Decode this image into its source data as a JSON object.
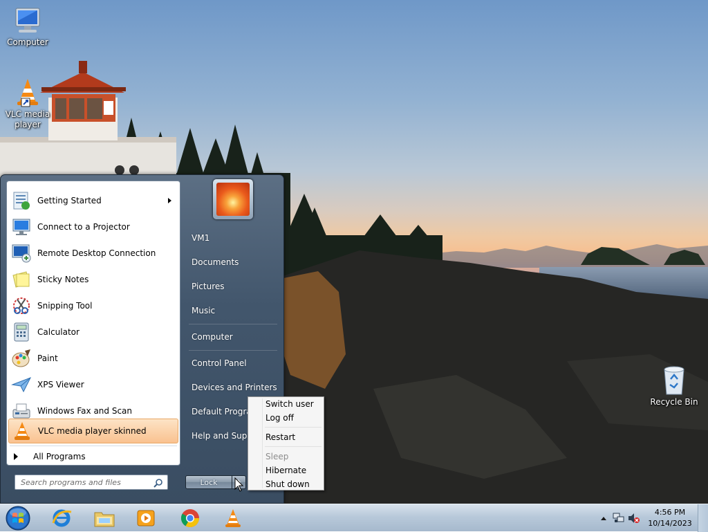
{
  "desktop": {
    "icons": [
      {
        "label": "Computer",
        "icon": "computer-icon"
      },
      {
        "label": "VLC media player",
        "icon": "vlc-cone-icon"
      },
      {
        "label": "Recycle Bin",
        "icon": "recycle-bin-icon"
      }
    ]
  },
  "start_menu": {
    "programs": [
      {
        "label": "Getting Started",
        "icon": "getting-started-icon",
        "has_submenu": true
      },
      {
        "label": "Connect to a Projector",
        "icon": "projector-icon"
      },
      {
        "label": "Remote Desktop Connection",
        "icon": "remote-desktop-icon"
      },
      {
        "label": "Sticky Notes",
        "icon": "sticky-notes-icon"
      },
      {
        "label": "Snipping Tool",
        "icon": "snipping-tool-icon"
      },
      {
        "label": "Calculator",
        "icon": "calculator-icon"
      },
      {
        "label": "Paint",
        "icon": "paint-icon"
      },
      {
        "label": "XPS Viewer",
        "icon": "xps-viewer-icon"
      },
      {
        "label": "Windows Fax and Scan",
        "icon": "fax-scan-icon"
      },
      {
        "label": "VLC media player skinned",
        "icon": "vlc-cone-icon",
        "highlighted": true
      }
    ],
    "all_programs": "All Programs",
    "search_placeholder": "Search programs and files",
    "right_links": [
      {
        "label": "VM1"
      },
      {
        "label": "Documents"
      },
      {
        "label": "Pictures"
      },
      {
        "label": "Music"
      },
      {
        "label": "Computer"
      },
      {
        "label": "Control Panel"
      },
      {
        "label": "Devices and Printers"
      },
      {
        "label": "Default Programs"
      },
      {
        "label": "Help and Support"
      }
    ],
    "lock_label": "Lock"
  },
  "power_menu": {
    "items": [
      {
        "label": "Switch user",
        "enabled": true
      },
      {
        "label": "Log off",
        "enabled": true
      },
      {
        "label": "Restart",
        "enabled": true
      },
      {
        "label": "Sleep",
        "enabled": false
      },
      {
        "label": "Hibernate",
        "enabled": true
      },
      {
        "label": "Shut down",
        "enabled": true
      }
    ]
  },
  "taskbar": {
    "pinned": [
      {
        "icon": "internet-explorer-icon"
      },
      {
        "icon": "file-explorer-icon"
      },
      {
        "icon": "media-player-icon"
      },
      {
        "icon": "chrome-icon"
      },
      {
        "icon": "vlc-cone-icon"
      }
    ],
    "tray_icons": [
      "show-hidden-icons-icon",
      "network-icon",
      "volume-muted-icon"
    ],
    "time": "4:56 PM",
    "date": "10/14/2023"
  },
  "colors": {
    "highlight": "#f9c290",
    "start_menu_bg": "#42566c",
    "taskbar_bg": "#b8c9da"
  }
}
